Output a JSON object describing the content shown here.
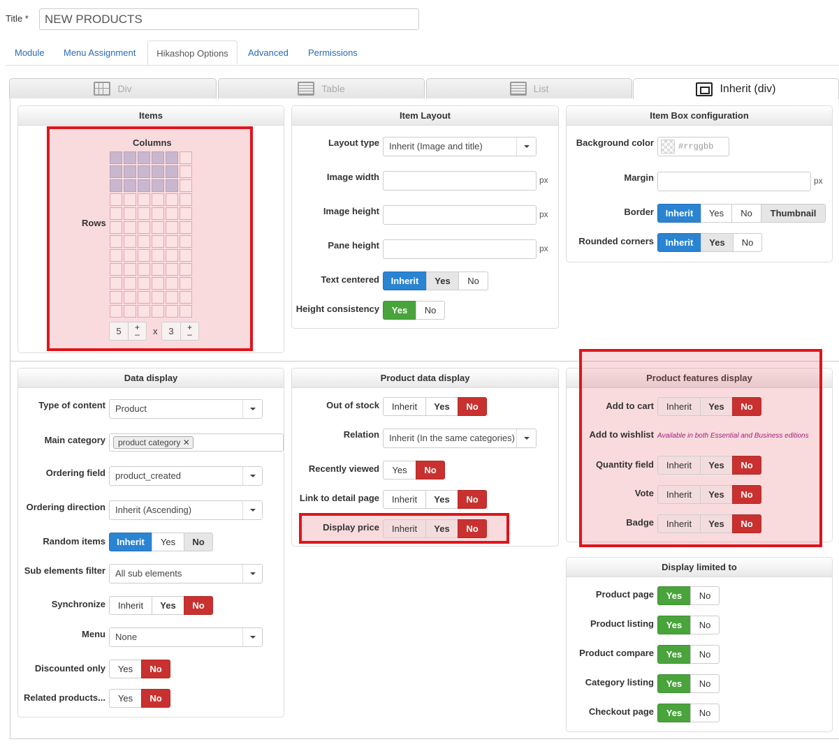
{
  "title_field": {
    "label": "Title *",
    "value": "NEW PRODUCTS"
  },
  "nav_tabs": [
    "Module",
    "Menu Assignment",
    "Hikashop Options",
    "Advanced",
    "Permissions"
  ],
  "layout_tabs": [
    {
      "label": "Div",
      "icon": "grid-icon"
    },
    {
      "label": "Table",
      "icon": "table-icon"
    },
    {
      "label": "List",
      "icon": "list-icon"
    },
    {
      "label": "Inherit (div)",
      "icon": "inherit-icon"
    }
  ],
  "items_panel": {
    "title": "Items",
    "columns_label": "Columns",
    "rows_label": "Rows",
    "columns": "5",
    "rows": "3",
    "times": "x",
    "plus": "+",
    "minus": "–"
  },
  "item_layout": {
    "title": "Item Layout",
    "layout_type_label": "Layout type",
    "layout_type_value": "Inherit (Image and title)",
    "image_width_label": "Image width",
    "image_height_label": "Image height",
    "pane_height_label": "Pane height",
    "unit": "px",
    "text_centered_label": "Text centered",
    "height_consistency_label": "Height consistency"
  },
  "item_box": {
    "title": "Item Box configuration",
    "bg_color_label": "Background color",
    "bg_color_placeholder": "#rrggbb",
    "margin_label": "Margin",
    "border_label": "Border",
    "rounded_label": "Rounded corners",
    "unit": "px"
  },
  "buttons": {
    "inherit": "Inherit",
    "yes": "Yes",
    "no": "No",
    "thumbnail": "Thumbnail"
  },
  "data_display": {
    "title": "Data display",
    "type_label": "Type of content",
    "type_value": "Product",
    "main_category_label": "Main category",
    "main_category_tag": "product category",
    "ordering_field_label": "Ordering field",
    "ordering_field_value": "product_created",
    "ordering_dir_label": "Ordering direction",
    "ordering_dir_value": "Inherit (Ascending)",
    "random_label": "Random items",
    "sub_filter_label": "Sub elements filter",
    "sub_filter_value": "All sub elements",
    "sync_label": "Synchronize",
    "menu_label": "Menu",
    "menu_value": "None",
    "discounted_label": "Discounted only",
    "related_label": "Related products..."
  },
  "product_data": {
    "title": "Product data display",
    "out_of_stock_label": "Out of stock",
    "relation_label": "Relation",
    "relation_value": "Inherit (In the same categories)",
    "recently_viewed_label": "Recently viewed",
    "link_detail_label": "Link to detail page",
    "display_price_label": "Display price"
  },
  "product_features": {
    "title": "Product features display",
    "add_to_cart_label": "Add to cart",
    "add_to_wishlist_label": "Add to wishlist",
    "wishlist_note": "Available in both Essential and Business editions",
    "quantity_label": "Quantity field",
    "vote_label": "Vote",
    "badge_label": "Badge"
  },
  "display_limited": {
    "title": "Display limited to",
    "product_page_label": "Product page",
    "product_listing_label": "Product listing",
    "product_compare_label": "Product compare",
    "category_listing_label": "Category listing",
    "checkout_page_label": "Checkout page"
  },
  "colors": {
    "inherit_active": "#2a84d2",
    "yes_active": "#4aa43c",
    "no_active": "#c8312f",
    "highlight": "#e0141b"
  }
}
